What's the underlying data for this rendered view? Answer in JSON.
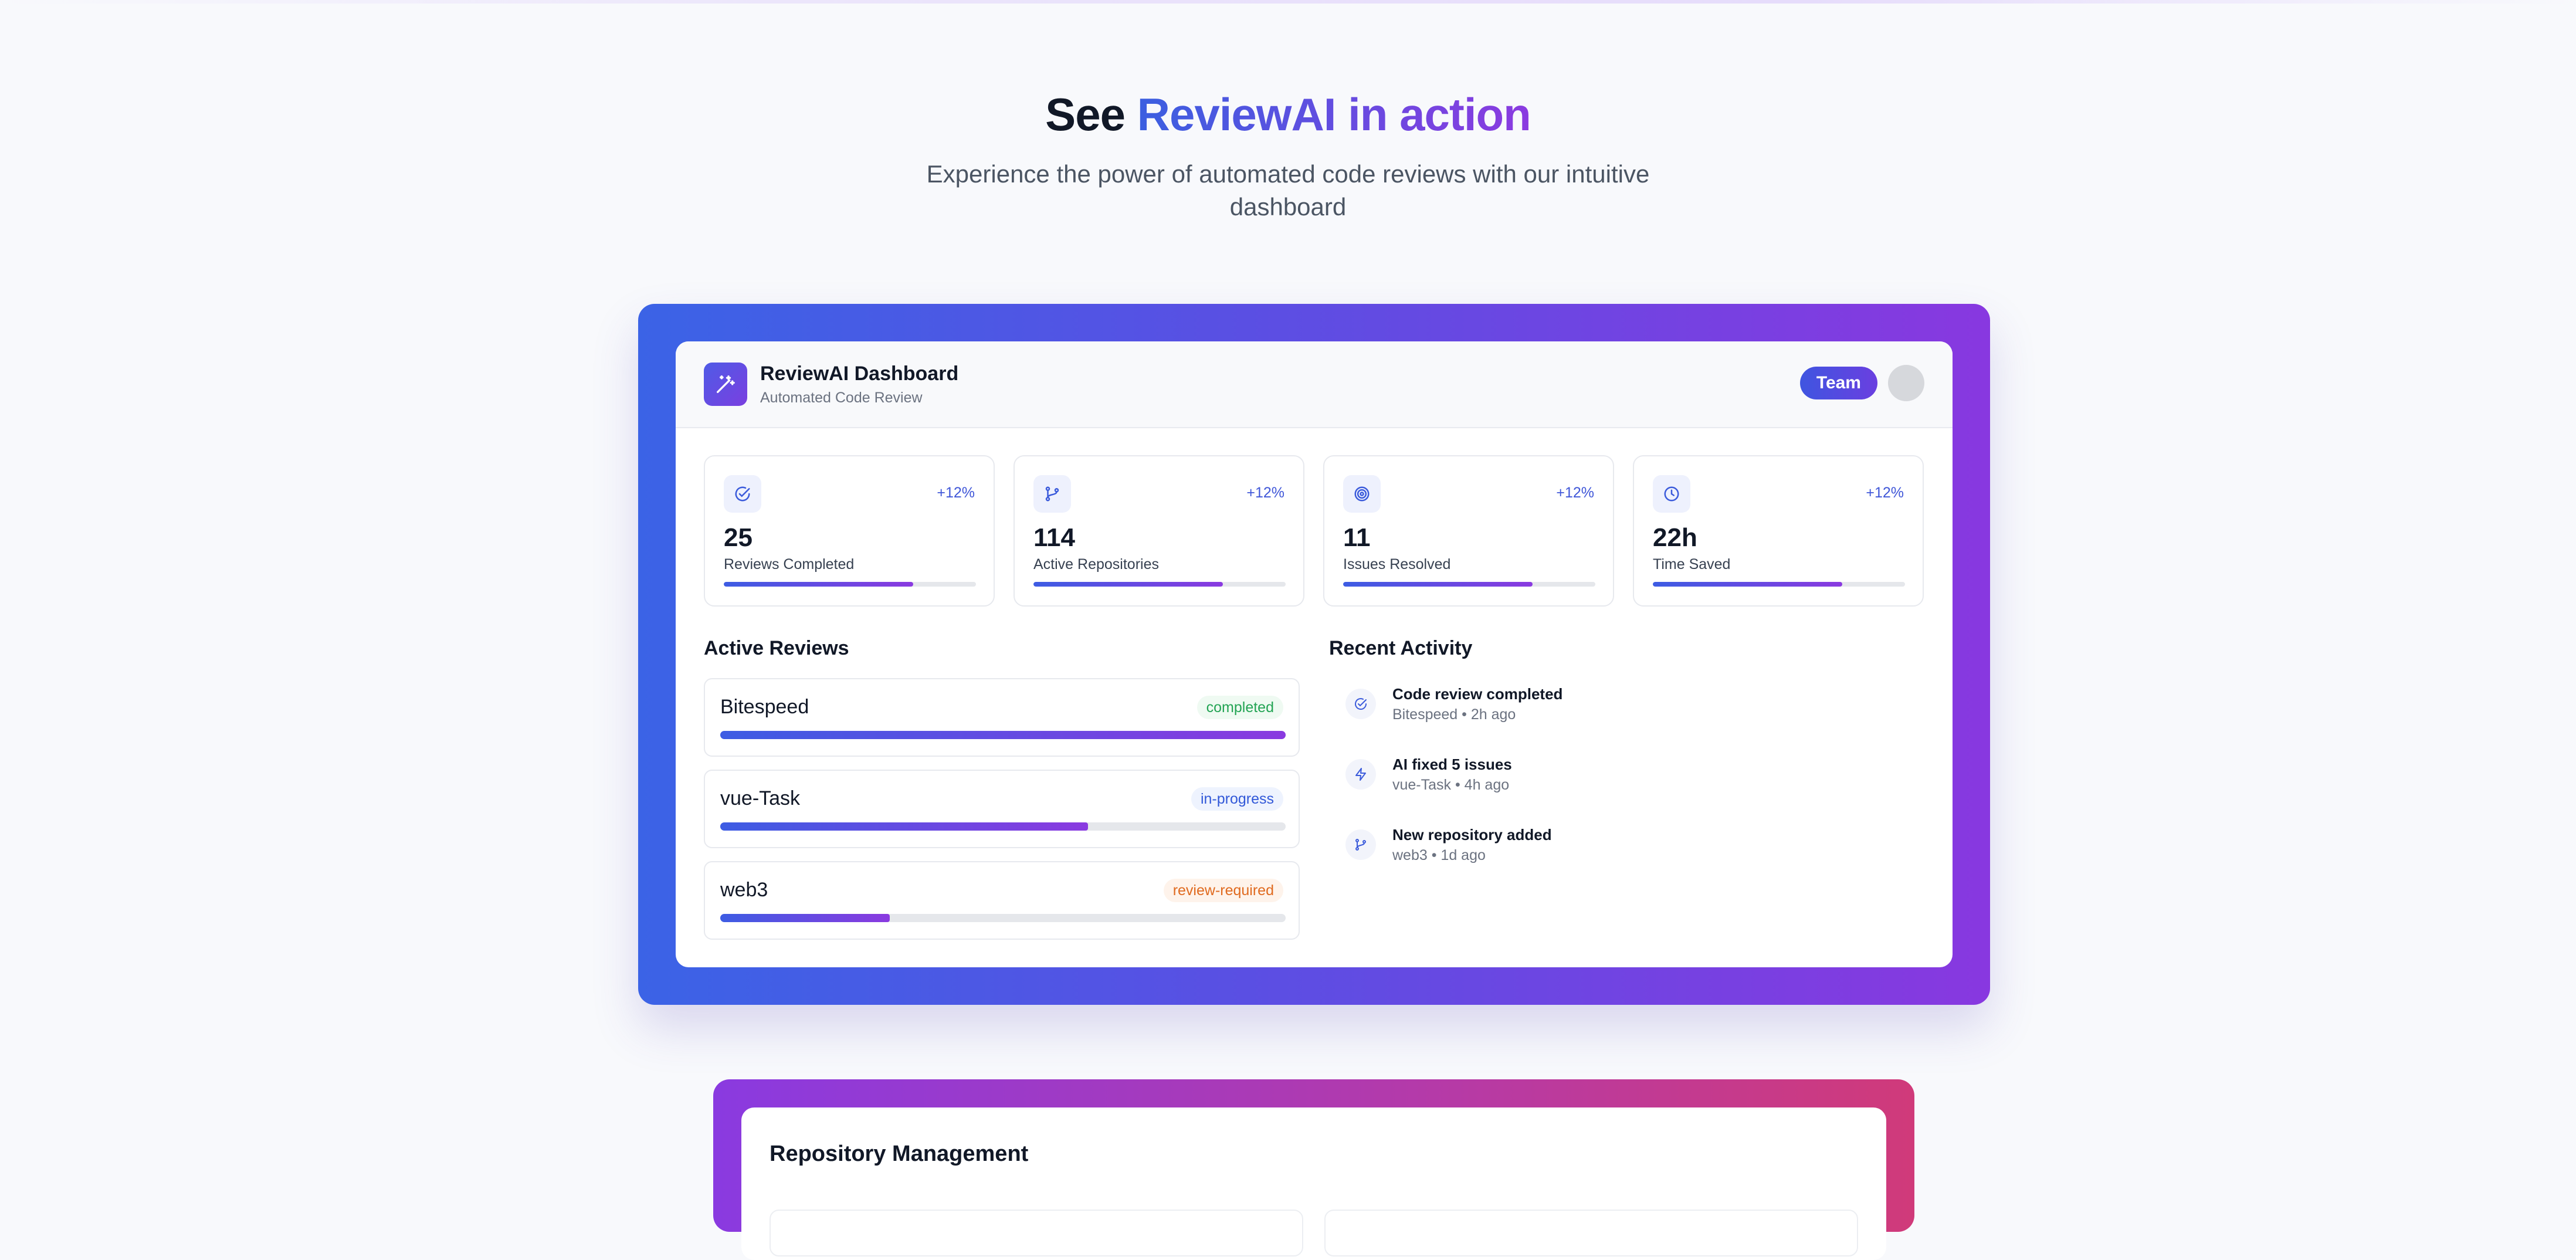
{
  "hero": {
    "title_prefix": "See ",
    "title_accent": "ReviewAI in action",
    "subtitle": "Experience the power of automated code reviews with our intuitive dashboard"
  },
  "dashboard": {
    "title": "ReviewAI Dashboard",
    "subtitle": "Automated Code Review",
    "logo_icon": "magic-wand-icon",
    "team_label": "Team",
    "colors": {
      "accent_start": "#3b63e6",
      "accent_end": "#8838e0"
    }
  },
  "stats": [
    {
      "icon": "check-circle-icon",
      "delta": "+12%",
      "value": "25",
      "label": "Reviews Completed",
      "progress": 0.75
    },
    {
      "icon": "git-branch-icon",
      "delta": "+12%",
      "value": "114",
      "label": "Active Repositories",
      "progress": 0.75
    },
    {
      "icon": "target-icon",
      "delta": "+12%",
      "value": "11",
      "label": "Issues Resolved",
      "progress": 0.75
    },
    {
      "icon": "clock-icon",
      "delta": "+12%",
      "value": "22h",
      "label": "Time Saved",
      "progress": 0.75
    }
  ],
  "active_reviews": {
    "title": "Active Reviews",
    "items": [
      {
        "name": "Bitespeed",
        "status": "completed",
        "progress": 1.0
      },
      {
        "name": "vue-Task",
        "status": "in-progress",
        "progress": 0.65
      },
      {
        "name": "web3",
        "status": "review-required",
        "progress": 0.3
      }
    ]
  },
  "recent_activity": {
    "title": "Recent Activity",
    "items": [
      {
        "icon": "check-circle-icon",
        "title": "Code review completed",
        "meta": "Bitespeed • 2h ago"
      },
      {
        "icon": "lightning-icon",
        "title": "AI fixed 5 issues",
        "meta": "vue-Task • 4h ago"
      },
      {
        "icon": "git-branch-icon",
        "title": "New repository added",
        "meta": "web3 • 1d ago"
      }
    ]
  },
  "repository_management": {
    "title": "Repository Management"
  }
}
